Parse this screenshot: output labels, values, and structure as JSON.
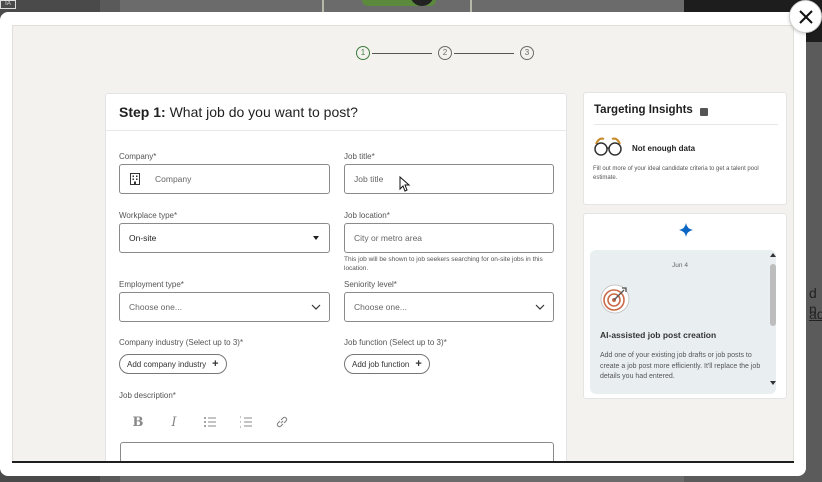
{
  "background": {
    "badge": "IA",
    "link_1": "d n",
    "link_2": "ad"
  },
  "stepper": {
    "steps": [
      "1",
      "2",
      "3"
    ],
    "current": 1
  },
  "form": {
    "title_prefix": "Step 1:",
    "title_text": "What job do you want to post?",
    "company": {
      "label": "Company*",
      "placeholder": "Company"
    },
    "job_title": {
      "label": "Job title*",
      "placeholder": "Job title"
    },
    "workplace_type": {
      "label": "Workplace type*",
      "value": "On-site"
    },
    "job_location": {
      "label": "Job location*",
      "placeholder": "City or metro area",
      "helper": "This job will be shown to job seekers searching for on-site jobs in this location."
    },
    "employment_type": {
      "label": "Employment type*",
      "value": "Choose one..."
    },
    "seniority_level": {
      "label": "Seniority level*",
      "value": "Choose one..."
    },
    "company_industry": {
      "label": "Company industry (Select up to 3)*",
      "button": "Add company industry"
    },
    "job_function": {
      "label": "Job function (Select up to 3)*",
      "button": "Add job function"
    },
    "job_description": {
      "label": "Job description*"
    },
    "toolbar": [
      "bold-icon",
      "italic-icon",
      "bulleted-list-icon",
      "numbered-list-icon",
      "link-icon"
    ]
  },
  "insights": {
    "title": "Targeting Insights",
    "status": "Not enough data",
    "description": "Fill out more of your ideal candidate criteria to get a talent pool estimate."
  },
  "ai_panel": {
    "date": "Jun 4",
    "heading": "AI-assisted job post creation",
    "body": "Add one of your existing job drafts or job posts to create a job post more efficiently. It'll replace the job details you had entered."
  },
  "colors": {
    "accent_green": "#3e7d3e",
    "sparkle_blue": "#0a66c2",
    "panel_bg": "#f3f2ee"
  }
}
